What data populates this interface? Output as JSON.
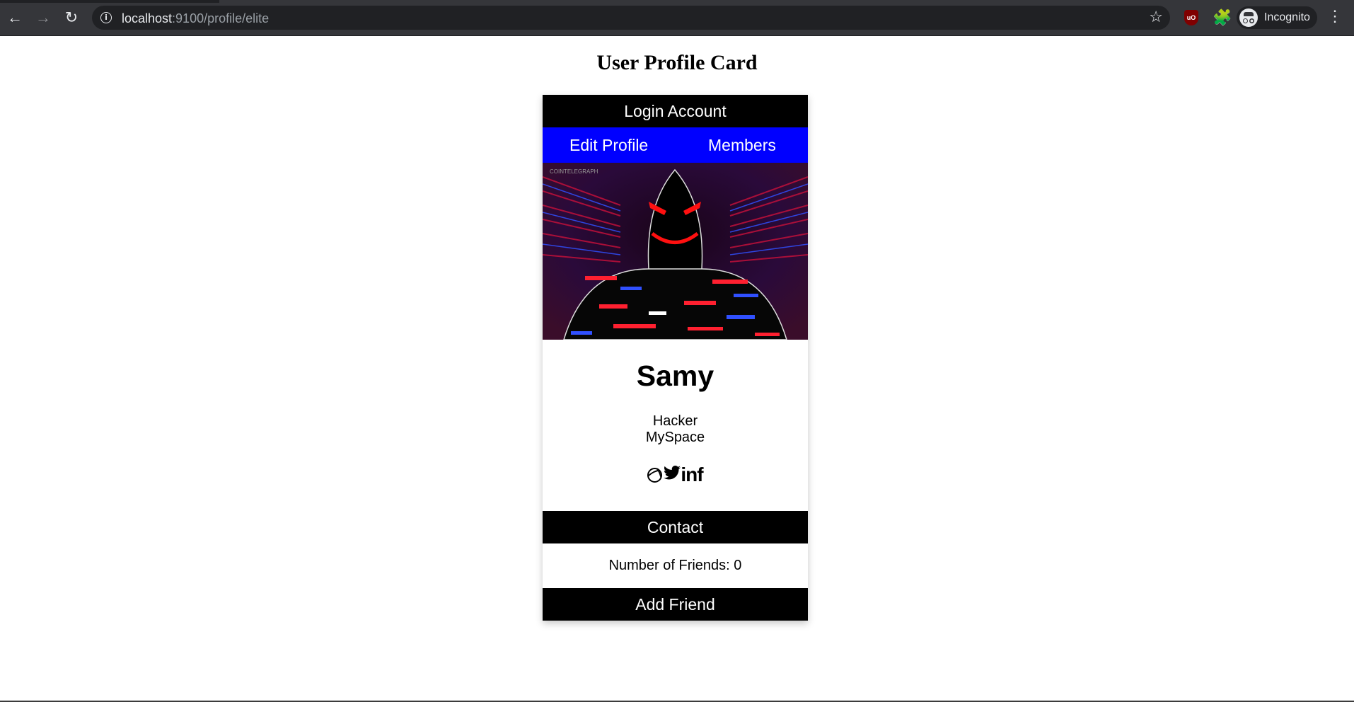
{
  "browser": {
    "url_host": "localhost",
    "url_rest": ":9100/profile/elite",
    "profile_label": "Incognito",
    "ublock_label": "uO"
  },
  "page": {
    "heading": "User Profile Card"
  },
  "card": {
    "login_label": "Login Account",
    "nav": {
      "edit_label": "Edit Profile",
      "members_label": "Members"
    },
    "image_watermark": "COINTELEGRAPH",
    "name": "Samy",
    "title": "Hacker",
    "company": "MySpace",
    "socials": {
      "icons": [
        "dribbble-icon",
        "twitter-icon",
        "linkedin-icon",
        "facebook-icon"
      ],
      "twitter_glyph": "🐦",
      "linkedin_text": "in",
      "facebook_text": "f"
    },
    "contact_label": "Contact",
    "friends_label": "Number of Friends: 0",
    "add_friend_label": "Add Friend"
  },
  "colors": {
    "nav_blue": "#0000ff",
    "bar_black": "#000000",
    "chrome_dark": "#35363a"
  }
}
